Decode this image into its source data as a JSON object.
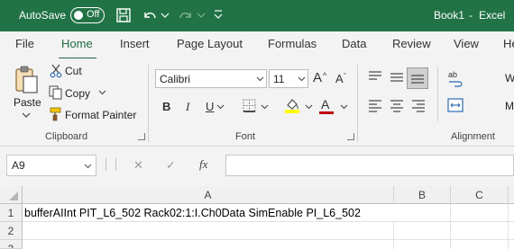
{
  "titlebar": {
    "autosave_label": "AutoSave",
    "autosave_state": "Off",
    "doc_title": "Book1",
    "separator": "-",
    "app_name": "Excel",
    "save_icon": "save-icon",
    "undo_icon": "undo-icon",
    "redo_icon": "redo-icon",
    "customize_icon": "chevron-down-icon"
  },
  "tabs": [
    "File",
    "Home",
    "Insert",
    "Page Layout",
    "Formulas",
    "Data",
    "Review",
    "View",
    "He"
  ],
  "active_tab": "Home",
  "ribbon": {
    "clipboard": {
      "paste": "Paste",
      "cut": "Cut",
      "copy": "Copy",
      "format_painter": "Format Painter",
      "group_label": "Clipboard"
    },
    "font": {
      "font_name": "Calibri",
      "font_size": "11",
      "bold": "B",
      "italic": "I",
      "underline": "U",
      "grow": "A",
      "shrink": "A",
      "font_color_letter": "A",
      "group_label": "Font"
    },
    "alignment": {
      "wrap_partial": "ab",
      "wrap_w": "W",
      "merge_partial": "M",
      "group_label": "Alignment"
    }
  },
  "formula_bar": {
    "name_box": "A9",
    "cancel": "✕",
    "enter": "✓",
    "fx": "fx",
    "formula": ""
  },
  "sheet": {
    "columns": [
      "A",
      "B",
      "C"
    ],
    "rows": [
      "1",
      "2",
      "3"
    ],
    "cells": {
      "A1": "bufferAIInt PIT_L6_502 Rack02:1:I.Ch0Data SimEnable PI_L6_502"
    }
  },
  "colors": {
    "accent": "#217346",
    "tab_active": "#1e6b41",
    "font_color_bar": "#c00000",
    "highlight_bar": "#ffff00"
  }
}
